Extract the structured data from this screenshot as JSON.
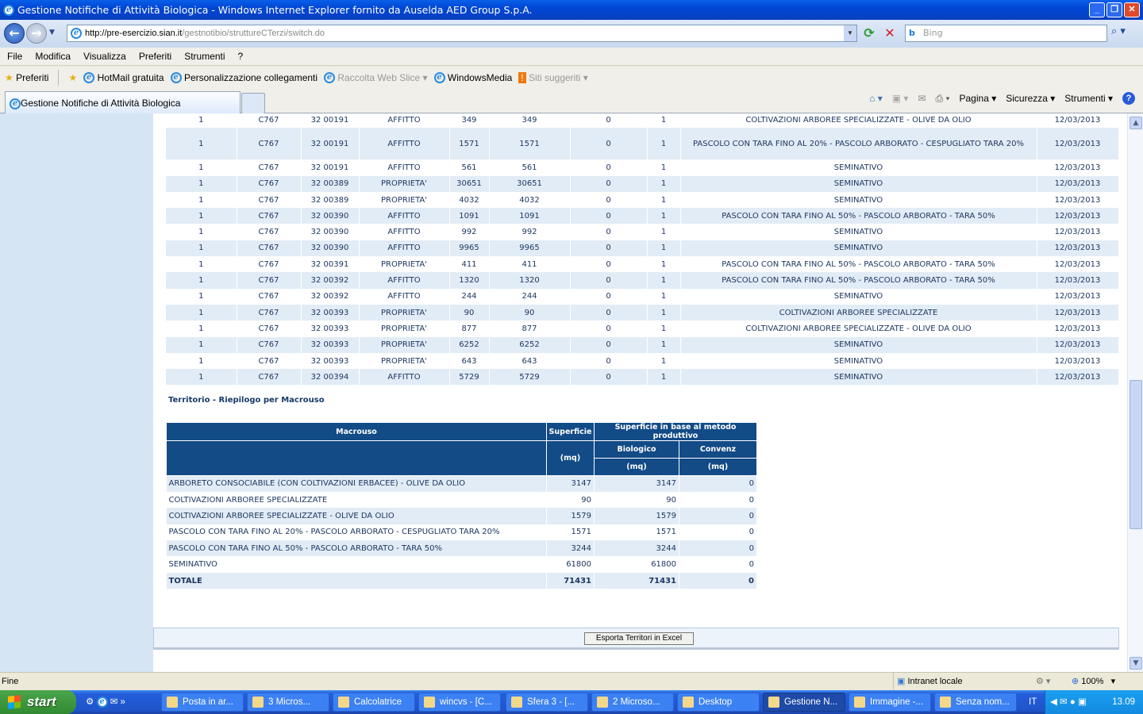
{
  "window": {
    "title": "Gestione Notifiche di Attività Biologica - Windows Internet Explorer fornito da Auselda AED Group S.p.A."
  },
  "address": {
    "host": "http://pre-esercizio.sian.it",
    "path": "/gestnotibio/struttureCTerzi/switch.do",
    "search_placeholder": "Bing"
  },
  "menu": [
    "File",
    "Modifica",
    "Visualizza",
    "Preferiti",
    "Strumenti",
    "?"
  ],
  "favorites": {
    "label": "Preferiti",
    "links": [
      {
        "label": "HotMail gratuita",
        "enabled": true
      },
      {
        "label": "Personalizzazione collegamenti",
        "enabled": true
      },
      {
        "label": "Raccolta Web Slice",
        "enabled": false
      },
      {
        "label": "WindowsMedia",
        "enabled": true
      },
      {
        "label": "Siti suggeriti",
        "enabled": false
      }
    ]
  },
  "tab": {
    "label": "Gestione Notifiche di Attività Biologica"
  },
  "command_bar": [
    "Pagina",
    "Sicurezza",
    "Strumenti"
  ],
  "plots": [
    [
      "1",
      "C767",
      "32 00191",
      "AFFITTO",
      "349",
      "349",
      "0",
      "1",
      "COLTIVAZIONI ARBOREE SPECIALIZZATE - OLIVE DA OLIO",
      "12/03/2013"
    ],
    [
      "1",
      "C767",
      "32 00191",
      "AFFITTO",
      "1571",
      "1571",
      "0",
      "1",
      "PASCOLO CON TARA FINO AL 20% - PASCOLO ARBORATO - CESPUGLIATO TARA 20%",
      "12/03/2013"
    ],
    [
      "1",
      "C767",
      "32 00191",
      "AFFITTO",
      "561",
      "561",
      "0",
      "1",
      "SEMINATIVO",
      "12/03/2013"
    ],
    [
      "1",
      "C767",
      "32 00389",
      "PROPRIETA'",
      "30651",
      "30651",
      "0",
      "1",
      "SEMINATIVO",
      "12/03/2013"
    ],
    [
      "1",
      "C767",
      "32 00389",
      "PROPRIETA'",
      "4032",
      "4032",
      "0",
      "1",
      "SEMINATIVO",
      "12/03/2013"
    ],
    [
      "1",
      "C767",
      "32 00390",
      "AFFITTO",
      "1091",
      "1091",
      "0",
      "1",
      "PASCOLO CON TARA FINO AL 50% - PASCOLO ARBORATO - TARA 50%",
      "12/03/2013"
    ],
    [
      "1",
      "C767",
      "32 00390",
      "AFFITTO",
      "992",
      "992",
      "0",
      "1",
      "SEMINATIVO",
      "12/03/2013"
    ],
    [
      "1",
      "C767",
      "32 00390",
      "AFFITTO",
      "9965",
      "9965",
      "0",
      "1",
      "SEMINATIVO",
      "12/03/2013"
    ],
    [
      "1",
      "C767",
      "32 00391",
      "PROPRIETA'",
      "411",
      "411",
      "0",
      "1",
      "PASCOLO CON TARA FINO AL 50% - PASCOLO ARBORATO - TARA 50%",
      "12/03/2013"
    ],
    [
      "1",
      "C767",
      "32 00392",
      "AFFITTO",
      "1320",
      "1320",
      "0",
      "1",
      "PASCOLO CON TARA FINO AL 50% - PASCOLO ARBORATO - TARA 50%",
      "12/03/2013"
    ],
    [
      "1",
      "C767",
      "32 00392",
      "AFFITTO",
      "244",
      "244",
      "0",
      "1",
      "SEMINATIVO",
      "12/03/2013"
    ],
    [
      "1",
      "C767",
      "32 00393",
      "PROPRIETA'",
      "90",
      "90",
      "0",
      "1",
      "COLTIVAZIONI ARBOREE SPECIALIZZATE",
      "12/03/2013"
    ],
    [
      "1",
      "C767",
      "32 00393",
      "PROPRIETA'",
      "877",
      "877",
      "0",
      "1",
      "COLTIVAZIONI ARBOREE SPECIALIZZATE - OLIVE DA OLIO",
      "12/03/2013"
    ],
    [
      "1",
      "C767",
      "32 00393",
      "PROPRIETA'",
      "6252",
      "6252",
      "0",
      "1",
      "SEMINATIVO",
      "12/03/2013"
    ],
    [
      "1",
      "C767",
      "32 00393",
      "PROPRIETA'",
      "643",
      "643",
      "0",
      "1",
      "SEMINATIVO",
      "12/03/2013"
    ],
    [
      "1",
      "C767",
      "32 00394",
      "AFFITTO",
      "5729",
      "5729",
      "0",
      "1",
      "SEMINATIVO",
      "12/03/2013"
    ]
  ],
  "summary": {
    "title": "Territorio - Riepilogo per Macrouso",
    "headers": {
      "macrouso": "Macrouso",
      "superficie": "Superficie",
      "metodo": "Superficie in base al metodo produttivo",
      "biologico": "Biologico",
      "convenz": "Convenz",
      "unit": "(mq)"
    },
    "rows": [
      [
        "ARBORETO CONSOCIABILE (CON COLTIVAZIONI ERBACEE) - OLIVE DA OLIO",
        "3147",
        "3147",
        "0"
      ],
      [
        "COLTIVAZIONI ARBOREE SPECIALIZZATE",
        "90",
        "90",
        "0"
      ],
      [
        "COLTIVAZIONI ARBOREE SPECIALIZZATE - OLIVE DA OLIO",
        "1579",
        "1579",
        "0"
      ],
      [
        "PASCOLO CON TARA FINO AL 20% - PASCOLO ARBORATO - CESPUGLIATO TARA 20%",
        "1571",
        "1571",
        "0"
      ],
      [
        "PASCOLO CON TARA FINO AL 50% - PASCOLO ARBORATO - TARA 50%",
        "3244",
        "3244",
        "0"
      ],
      [
        "SEMINATIVO",
        "61800",
        "61800",
        "0"
      ]
    ],
    "total": [
      "TOTALE",
      "71431",
      "71431",
      "0"
    ]
  },
  "export_button": "Esporta Territori in Excel",
  "status": {
    "text": "Fine",
    "zone": "Intranet locale",
    "zoom": "100%"
  },
  "taskbar": {
    "start": "start",
    "items": [
      "Posta in ar...",
      "3 Micros...",
      "Calcolatrice",
      "wincvs - [C...",
      "Sfera 3 - [...",
      "2 Microso...",
      "Desktop",
      "Gestione N...",
      "Immagine -...",
      "Senza nom..."
    ],
    "active_index": 7,
    "lang": "IT",
    "clock": "13.09"
  }
}
